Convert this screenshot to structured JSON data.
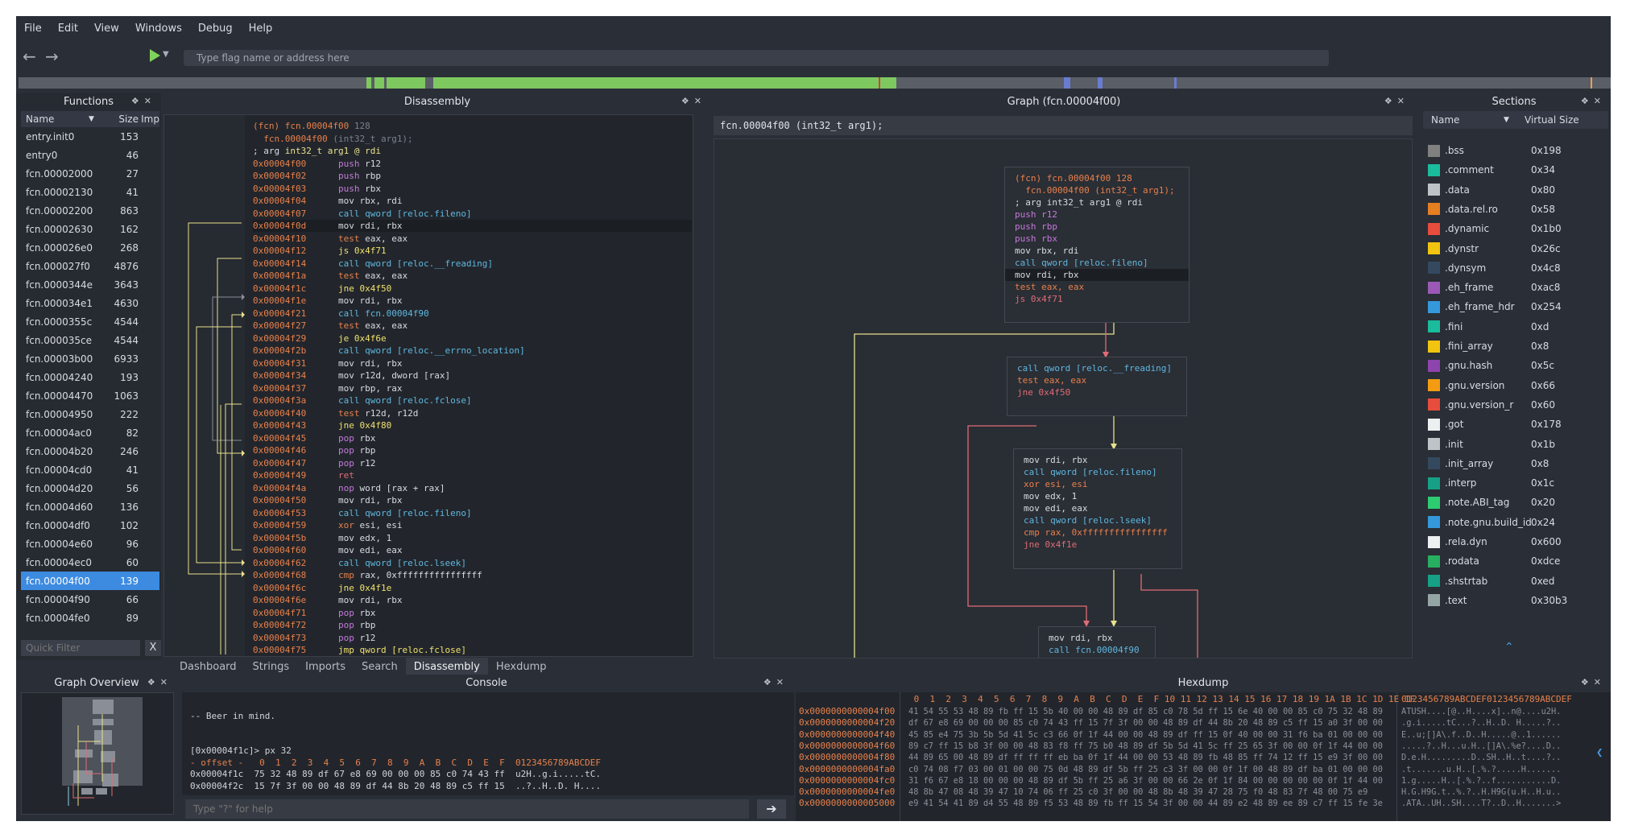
{
  "menu": [
    "File",
    "Edit",
    "View",
    "Windows",
    "Debug",
    "Help"
  ],
  "toolbar": {
    "back_icon": "arrow-left-icon",
    "forward_icon": "arrow-right-icon",
    "run_icon": "play-icon",
    "flag_placeholder": "Type flag name or address here"
  },
  "functions": {
    "title": "Functions",
    "col_name": "Name",
    "col_size": "Size",
    "col_imp": "Imp",
    "items": [
      {
        "name": "entry.init0",
        "size": "153"
      },
      {
        "name": "entry0",
        "size": "46"
      },
      {
        "name": "fcn.00002000",
        "size": "27"
      },
      {
        "name": "fcn.00002130",
        "size": "41"
      },
      {
        "name": "fcn.00002200",
        "size": "863"
      },
      {
        "name": "fcn.00002630",
        "size": "162"
      },
      {
        "name": "fcn.000026e0",
        "size": "268"
      },
      {
        "name": "fcn.000027f0",
        "size": "4876"
      },
      {
        "name": "fcn.0000344e",
        "size": "3643"
      },
      {
        "name": "fcn.000034e1",
        "size": "4630"
      },
      {
        "name": "fcn.0000355c",
        "size": "4544"
      },
      {
        "name": "fcn.000035ce",
        "size": "4544"
      },
      {
        "name": "fcn.00003b00",
        "size": "6933"
      },
      {
        "name": "fcn.00004240",
        "size": "193"
      },
      {
        "name": "fcn.00004470",
        "size": "1063"
      },
      {
        "name": "fcn.00004950",
        "size": "222"
      },
      {
        "name": "fcn.00004ac0",
        "size": "82"
      },
      {
        "name": "fcn.00004b20",
        "size": "246"
      },
      {
        "name": "fcn.00004cd0",
        "size": "41"
      },
      {
        "name": "fcn.00004d20",
        "size": "56"
      },
      {
        "name": "fcn.00004d60",
        "size": "136"
      },
      {
        "name": "fcn.00004df0",
        "size": "102"
      },
      {
        "name": "fcn.00004e60",
        "size": "96"
      },
      {
        "name": "fcn.00004ec0",
        "size": "60"
      },
      {
        "name": "fcn.00004f00",
        "size": "139"
      },
      {
        "name": "fcn.00004f90",
        "size": "66"
      },
      {
        "name": "fcn.00004fe0",
        "size": "89"
      }
    ],
    "filter_placeholder": "Quick Filter",
    "filter_clear": "X"
  },
  "disasm": {
    "title": "Disassembly",
    "lines": [
      {
        "a": "",
        "m": "(fcn) fcn.00004f00",
        "o": "128",
        "t": "hdr"
      },
      {
        "a": "",
        "m": "  fcn.00004f00",
        "o": "(int32_t arg1);",
        "t": "hdr2"
      },
      {
        "a": "",
        "m": "; arg",
        "o": "int32_t arg1 @ rdi",
        "t": "arg"
      },
      {
        "a": "0x00004f00",
        "m": "push",
        "o": "r12",
        "t": "push"
      },
      {
        "a": "0x00004f02",
        "m": "push",
        "o": "rbp",
        "t": "push"
      },
      {
        "a": "0x00004f03",
        "m": "push",
        "o": "rbx",
        "t": "push"
      },
      {
        "a": "0x00004f04",
        "m": "mov",
        "o": "rbx, rdi",
        "t": "mov"
      },
      {
        "a": "0x00004f07",
        "m": "call",
        "o": "qword [reloc.fileno]",
        "t": "call"
      },
      {
        "a": "0x00004f0d",
        "m": "mov",
        "o": "rdi, rbx",
        "t": "mov"
      },
      {
        "a": "0x00004f10",
        "m": "test",
        "o": "eax, eax",
        "t": "test"
      },
      {
        "a": "0x00004f12",
        "m": "js",
        "o": "0x4f71",
        "t": "jmp"
      },
      {
        "a": "0x00004f14",
        "m": "call",
        "o": "qword [reloc.__freading]",
        "t": "call"
      },
      {
        "a": "0x00004f1a",
        "m": "test",
        "o": "eax, eax",
        "t": "test"
      },
      {
        "a": "0x00004f1c",
        "m": "jne",
        "o": "0x4f50",
        "t": "jmp"
      },
      {
        "a": "0x00004f1e",
        "m": "mov",
        "o": "rdi, rbx",
        "t": "mov"
      },
      {
        "a": "0x00004f21",
        "m": "call",
        "o": "fcn.00004f90",
        "t": "call"
      },
      {
        "a": "0x00004f27",
        "m": "test",
        "o": "eax, eax",
        "t": "test"
      },
      {
        "a": "0x00004f29",
        "m": "je",
        "o": "0x4f6e",
        "t": "jmp"
      },
      {
        "a": "0x00004f2b",
        "m": "call",
        "o": "qword [reloc.__errno_location]",
        "t": "call"
      },
      {
        "a": "0x00004f31",
        "m": "mov",
        "o": "rdi, rbx",
        "t": "mov"
      },
      {
        "a": "0x00004f34",
        "m": "mov",
        "o": "r12d, dword [rax]",
        "t": "mov"
      },
      {
        "a": "0x00004f37",
        "m": "mov",
        "o": "rbp, rax",
        "t": "mov"
      },
      {
        "a": "0x00004f3a",
        "m": "call",
        "o": "qword [reloc.fclose]",
        "t": "call"
      },
      {
        "a": "0x00004f40",
        "m": "test",
        "o": "r12d, r12d",
        "t": "test"
      },
      {
        "a": "0x00004f43",
        "m": "jne",
        "o": "0x4f80",
        "t": "jmp"
      },
      {
        "a": "0x00004f45",
        "m": "pop",
        "o": "rbx",
        "t": "push"
      },
      {
        "a": "0x00004f46",
        "m": "pop",
        "o": "rbp",
        "t": "push"
      },
      {
        "a": "0x00004f47",
        "m": "pop",
        "o": "r12",
        "t": "push"
      },
      {
        "a": "0x00004f49",
        "m": "ret",
        "o": "",
        "t": "ret"
      },
      {
        "a": "0x00004f4a",
        "m": "nop",
        "o": "word [rax + rax]",
        "t": "nop"
      },
      {
        "a": "0x00004f50",
        "m": "mov",
        "o": "rdi, rbx",
        "t": "mov"
      },
      {
        "a": "0x00004f53",
        "m": "call",
        "o": "qword [reloc.fileno]",
        "t": "call"
      },
      {
        "a": "0x00004f59",
        "m": "xor",
        "o": "esi, esi",
        "t": "test"
      },
      {
        "a": "0x00004f5b",
        "m": "mov",
        "o": "edx, 1",
        "t": "mov"
      },
      {
        "a": "0x00004f60",
        "m": "mov",
        "o": "edi, eax",
        "t": "mov"
      },
      {
        "a": "0x00004f62",
        "m": "call",
        "o": "qword [reloc.lseek]",
        "t": "call"
      },
      {
        "a": "0x00004f68",
        "m": "cmp",
        "o": "rax, 0xffffffffffffffff",
        "t": "test"
      },
      {
        "a": "0x00004f6c",
        "m": "jne",
        "o": "0x4f1e",
        "t": "jmp"
      },
      {
        "a": "0x00004f6e",
        "m": "mov",
        "o": "rdi, rbx",
        "t": "mov"
      },
      {
        "a": "0x00004f71",
        "m": "pop",
        "o": "rbx",
        "t": "push"
      },
      {
        "a": "0x00004f72",
        "m": "pop",
        "o": "rbp",
        "t": "push"
      },
      {
        "a": "0x00004f73",
        "m": "pop",
        "o": "r12",
        "t": "push"
      },
      {
        "a": "0x00004f75",
        "m": "jmp",
        "o": "qword [reloc.fclose]",
        "t": "jmp"
      }
    ],
    "tabs": [
      "Dashboard",
      "Strings",
      "Imports",
      "Search",
      "Disassembly",
      "Hexdump"
    ],
    "active_tab": "Disassembly"
  },
  "graph": {
    "title": "Graph (fcn.00004f00)",
    "addr_bar": "fcn.00004f00 (int32_t arg1);",
    "block1": [
      "(fcn) fcn.00004f00 128",
      "  fcn.00004f00 (int32_t arg1);",
      "; arg int32_t arg1 @ rdi",
      "push r12",
      "push rbp",
      "push rbx",
      "mov rbx, rdi",
      "call qword [reloc.fileno]",
      "mov rdi, rbx",
      "test eax, eax",
      "js 0x4f71"
    ],
    "block2": [
      "call qword [reloc.__freading]",
      "test eax, eax",
      "jne 0x4f50"
    ],
    "block3": [
      "mov rdi, rbx",
      "call qword [reloc.fileno]",
      "xor esi, esi",
      "mov edx, 1",
      "mov edi, eax",
      "call qword [reloc.lseek]",
      "cmp rax, 0xffffffffffffffff",
      "jne 0x4f1e"
    ],
    "block4": [
      "mov rdi, rbx",
      "call fcn.00004f90"
    ]
  },
  "sections": {
    "title": "Sections",
    "col_name": "Name",
    "col_vsize": "Virtual Size",
    "items": [
      {
        "name": ".bss",
        "size": "0x198",
        "color": "#808080"
      },
      {
        "name": ".comment",
        "size": "0x34",
        "color": "#1abc9c"
      },
      {
        "name": ".data",
        "size": "0x80",
        "color": "#bdc3c7"
      },
      {
        "name": ".data.rel.ro",
        "size": "0x58",
        "color": "#e67e22"
      },
      {
        "name": ".dynamic",
        "size": "0x1b0",
        "color": "#e74c3c"
      },
      {
        "name": ".dynstr",
        "size": "0x26c",
        "color": "#f1c40f"
      },
      {
        "name": ".dynsym",
        "size": "0x4c8",
        "color": "#34495e"
      },
      {
        "name": ".eh_frame",
        "size": "0xac8",
        "color": "#9b59b6"
      },
      {
        "name": ".eh_frame_hdr",
        "size": "0x254",
        "color": "#3498db"
      },
      {
        "name": ".fini",
        "size": "0xd",
        "color": "#1abc9c"
      },
      {
        "name": ".fini_array",
        "size": "0x8",
        "color": "#f1c40f"
      },
      {
        "name": ".gnu.hash",
        "size": "0x5c",
        "color": "#8e44ad"
      },
      {
        "name": ".gnu.version",
        "size": "0x66",
        "color": "#f39c12"
      },
      {
        "name": ".gnu.version_r",
        "size": "0x60",
        "color": "#e74c3c"
      },
      {
        "name": ".got",
        "size": "0x178",
        "color": "#ecf0f1"
      },
      {
        "name": ".init",
        "size": "0x1b",
        "color": "#bdc3c7"
      },
      {
        "name": ".init_array",
        "size": "0x8",
        "color": "#34495e"
      },
      {
        "name": ".interp",
        "size": "0x1c",
        "color": "#16a085"
      },
      {
        "name": ".note.ABI_tag",
        "size": "0x20",
        "color": "#2ecc71"
      },
      {
        "name": ".note.gnu.build_id",
        "size": "0x24",
        "color": "#3498db"
      },
      {
        "name": ".rela.dyn",
        "size": "0x600",
        "color": "#ecf0f1"
      },
      {
        "name": ".rodata",
        "size": "0xdce",
        "color": "#27ae60"
      },
      {
        "name": ".shstrtab",
        "size": "0xed",
        "color": "#16a085"
      },
      {
        "name": ".text",
        "size": "0x30b3",
        "color": "#95a5a6"
      }
    ]
  },
  "graph_overview": {
    "title": "Graph Overview"
  },
  "console": {
    "title": "Console",
    "lines": [
      "",
      "-- Beer in mind.",
      "",
      "",
      "[0x00004f1c]> px 32",
      "- offset -   0  1  2  3  4  5  6  7  8  9  A  B  C  D  E  F  0123456789ABCDEF",
      "0x00004f1c  75 32 48 89 df 67 e8 69 00 00 00 85 c0 74 43 ff  u2H..g.i.....tC.",
      "0x00004f2c  15 7f 3f 00 00 48 89 df 44 8b 20 48 89 c5 ff 15  ..?..H..D. H...."
    ],
    "placeholder": "Type \"?\" for help",
    "go": "➔"
  },
  "hexdump": {
    "title": "Hexdump",
    "header_hex": " 0  1  2  3  4  5  6  7  8  9  A  B  C  D  E  F 10 11 12 13 14 15 16 17 18 19 1A 1B 1C 1D 1E 1F",
    "header_ascii": "0123456789ABCDEF0123456789ABCDEF",
    "rows": [
      {
        "addr": "0x0000000000004f00",
        "hex": "41 54 55 53 48 89 fb ff 15 5b 40 00 00 48 89 df 85 c0 78 5d ff 15 6e 40 00 00 85 c0 75 32 48 89",
        "ascii": "ATUSH....[@..H....x]..n@....u2H."
      },
      {
        "addr": "0x0000000000004f20",
        "hex": "df 67 e8 69 00 00 00 85 c0 74 43 ff 15 7f 3f 00 00 48 89 df 44 8b 20 48 89 c5 ff 15 a0 3f 00 00",
        "ascii": ".g.i.....tC...?..H..D. H.....?.."
      },
      {
        "addr": "0x0000000000004f40",
        "hex": "45 85 e4 75 3b 5b 5d 41 5c c3 66 0f 1f 44 00 00 48 89 df ff 15 0f 40 00 00 31 f6 ba 01 00 00 00",
        "ascii": "E..u;[]A\\.f..D..H.....@..1......"
      },
      {
        "addr": "0x0000000000004f60",
        "hex": "89 c7 ff 15 b8 3f 00 00 48 83 f8 ff 75 b0 48 89 df 5b 5d 41 5c ff 25 65 3f 00 00 0f 1f 44 00 00",
        "ascii": ".....?..H...u.H..[]A\\.%e?....D.."
      },
      {
        "addr": "0x0000000000004f80",
        "hex": "44 89 65 00 48 89 df ff ff ff eb ba 0f 1f 44 00 00 53 48 89 fb 48 85 ff 74 12 ff 15 e9 3f 00 00",
        "ascii": "D.e.H.........D..SH..H..t....?.."
      },
      {
        "addr": "0x0000000000004fa0",
        "hex": "c0 74 08 f7 03 00 01 00 00 75 0d 48 89 df 5b ff 25 c3 3f 00 00 0f 1f 00 48 89 df ba 01 00 00 00",
        "ascii": ".t.......u.H..[.%.?.....H......."
      },
      {
        "addr": "0x0000000000004fc0",
        "hex": "31 f6 67 e8 18 00 00 00 48 89 df 5b ff 25 a6 3f 00 00 66 2e 0f 1f 84 00 00 00 00 00 0f 1f 44 00",
        "ascii": "1.g.....H..[.%.?..f...........D."
      },
      {
        "addr": "0x0000000000004fe0",
        "hex": "48 8b 47 08 48 39 47 10 74 06 ff 25 c0 3f 00 00 48 8b 48 39 47 28 75 f0 48 83 7f 48 00 75 e9",
        "ascii": "H.G.H9G.t..%.?..H.H9G(u.H..H.u.."
      },
      {
        "addr": "0x0000000000005000",
        "hex": "e9 41 54 41 89 d4 55 48 89 f5 53 48 89 fb ff 15 54 3f 00 00 44 89 e2 48 89 ee 89 c7 ff 15 fe 3e",
        "ascii": ".ATA..UH..SH....T?..D..H.......>"
      }
    ]
  },
  "colors": {
    "accent": "#3d8be0",
    "bg": "#2a2e36",
    "panel": "#262a31"
  }
}
